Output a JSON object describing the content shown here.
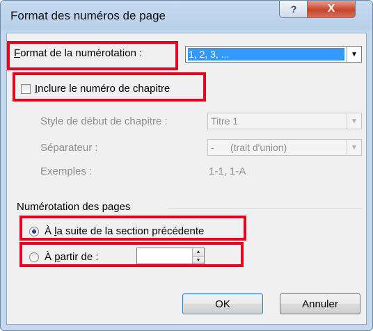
{
  "window": {
    "title": "Format des numéros de page",
    "help_glyph": "?",
    "close_glyph": "X"
  },
  "number_format": {
    "label_first": "F",
    "label_rest": "ormat de la numérotation :",
    "value": "1, 2, 3, ..."
  },
  "include_chapter": {
    "label_first": "I",
    "label_rest": "nclure le numéro de chapitre",
    "checked": false
  },
  "chapter_style": {
    "label": "Style de début de chapitre :",
    "value": "Titre 1"
  },
  "separator": {
    "label": "Séparateur :",
    "value": "-      (trait d'union)"
  },
  "examples": {
    "label": "Exemples :",
    "value": "1-1, 1-A"
  },
  "page_numbering": {
    "group_label": "Numérotation des pages",
    "continue_label_pre": "À ",
    "continue_label_acc": "l",
    "continue_label_post": "a suite de la section précédente",
    "start_label_pre": "À ",
    "start_label_acc": "p",
    "start_label_post": "artir de :",
    "start_value": "",
    "selected": "continue"
  },
  "buttons": {
    "ok": "OK",
    "cancel": "Annuler"
  },
  "colors": {
    "highlight": "#e8001c",
    "selection": "#3399ff"
  }
}
